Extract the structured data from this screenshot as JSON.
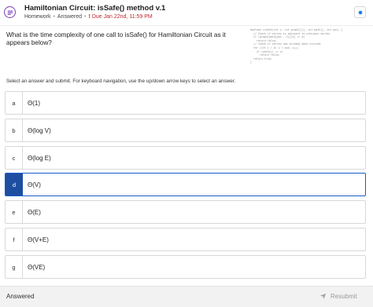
{
  "header": {
    "title": "Hamiltonian Circuit: isSafe() method v.1",
    "type": "Homework",
    "status": "Answered",
    "due": "Due Jan 22nd, 11:59 PM",
    "icon": "homework-icon",
    "accent": "#7b3fb8",
    "due_color": "#c2272d"
  },
  "question": {
    "text": "What is the time complexity of one call to isSafe() for Hamiltonian Circuit as it appears below?",
    "code_image": [
      "boolean isSafe(int v, int graph[][], int path[], int pos) {",
      "  // Check if vertex is adjacent to previous vertex",
      "  if (graph[path[pos - 1]][v] == 0)",
      "    return false;",
      "  // Check if vertex has already been visited",
      "  for (int i = 0; i < pos; i++)",
      "    if (path[i] == v)",
      "      return false;",
      "  return true;",
      "}"
    ]
  },
  "instructions": "Select an answer and submit. For keyboard navigation, use the up/down arrow keys to select an answer.",
  "options": [
    {
      "letter": "a",
      "text": "Θ(1)",
      "selected": false
    },
    {
      "letter": "b",
      "text": "Θ(log V)",
      "selected": false
    },
    {
      "letter": "c",
      "text": "Θ(log E)",
      "selected": false
    },
    {
      "letter": "d",
      "text": "Θ(V)",
      "selected": true
    },
    {
      "letter": "e",
      "text": "Θ(E)",
      "selected": false
    },
    {
      "letter": "f",
      "text": "Θ(V+E)",
      "selected": false
    },
    {
      "letter": "g",
      "text": "Θ(VE)",
      "selected": false
    }
  ],
  "footer": {
    "status": "Answered",
    "resubmit_label": "Resubmit",
    "resubmit_icon": "send-icon"
  },
  "colors": {
    "selected": "#1e4ea1",
    "settings_dot": "#1a73e8"
  }
}
